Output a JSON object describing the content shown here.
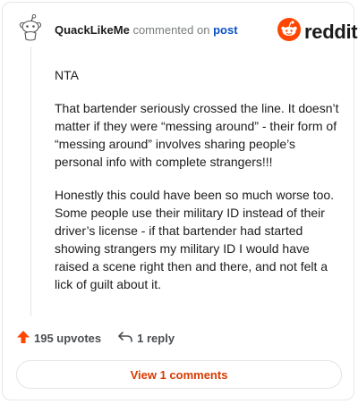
{
  "comment": {
    "username": "QuackLikeMe",
    "action_text": "commented on",
    "post_link_text": "post",
    "paragraphs": [
      "NTA",
      "That bartender seriously crossed the line. It doesn’t matter if they were “messing around” - their form of “messing around” involves sharing people’s personal info with complete strangers!!!",
      "Honestly this could have been so much worse too. Some people use their military ID instead of their driver’s license - if that bartender had started showing strangers my military ID I would have raised a scene right then and there, and not felt a lick of guilt about it."
    ],
    "upvotes_label": "195 upvotes",
    "replies_label": "1 reply",
    "view_comments_label": "View 1 comments"
  },
  "brand": {
    "wordmark": "reddit",
    "accent_color": "#ff4500",
    "link_color": "#0a53c5"
  },
  "icons": {
    "avatar": "snoo-avatar-icon",
    "logo": "reddit-logo-icon",
    "upvote": "upvote-arrow-icon",
    "reply": "reply-arrow-icon"
  }
}
